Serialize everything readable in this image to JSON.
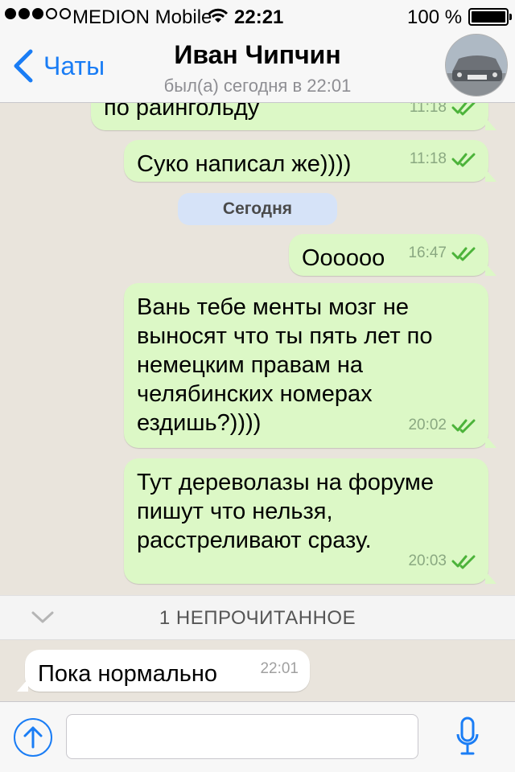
{
  "status_bar": {
    "carrier": "MEDION Mobile",
    "time": "22:21",
    "battery": "100 %"
  },
  "header": {
    "back_label": "Чаты",
    "contact_name": "Иван Чипчин",
    "contact_status": "был(а) сегодня в 22:01"
  },
  "messages": [
    {
      "direction": "out",
      "text": "по раингольду",
      "time": "11:18"
    },
    {
      "direction": "out",
      "text": "Суко написал же))))",
      "time": "11:18"
    },
    {
      "direction": "out",
      "text": "Оооооо",
      "time": "16:47"
    },
    {
      "direction": "out",
      "lines": [
        "Вань тебе менты мозг не",
        "выносят что ты пять лет по",
        "немецким правам на",
        "челябинских номерах",
        "ездишь?))))"
      ],
      "time": "20:02"
    },
    {
      "direction": "out",
      "lines": [
        "Тут дереволазы на форуме",
        "пишут что нельзя,",
        "расстреливают сразу."
      ],
      "time": "20:03"
    },
    {
      "direction": "in",
      "text": "Пока нормально",
      "time": "22:01"
    }
  ],
  "date_separator": "Сегодня",
  "unread_banner": "1 НЕПРОЧИТАННОЕ",
  "input": {
    "value": "",
    "placeholder": ""
  },
  "colors": {
    "accent": "#1a7df5",
    "outgoing_bubble": "#dcf8c6",
    "chat_background": "#e9e4dc",
    "read_ticks": "#4cb33a",
    "date_pill": "#d6e3f8"
  }
}
